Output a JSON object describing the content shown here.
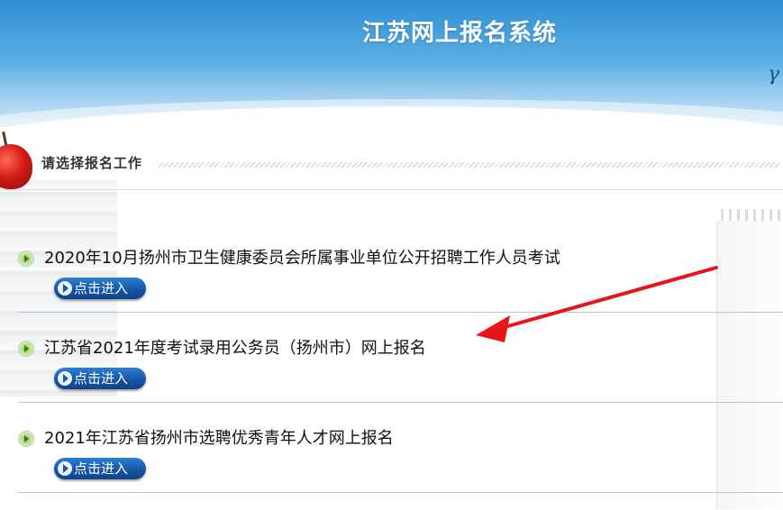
{
  "header": {
    "title": "江苏网上报名系统"
  },
  "section": {
    "title": "请选择报名工作"
  },
  "items": [
    {
      "label": "2020年10月扬州市卫生健康委员会所属事业单位公开招聘工作人员考试",
      "button": "点击进入"
    },
    {
      "label": "江苏省2021年度考试录用公务员（扬州市）网上报名",
      "button": "点击进入"
    },
    {
      "label": "2021年江苏省扬州市选聘优秀青年人才网上报名",
      "button": "点击进入"
    }
  ],
  "colors": {
    "header_blue": "#2f8fd3",
    "button_blue": "#1657a8",
    "arrow_red": "#e8141c"
  },
  "icons": {
    "bullet": "play-circle-icon",
    "button_arrow": "arrow-circle-icon"
  }
}
